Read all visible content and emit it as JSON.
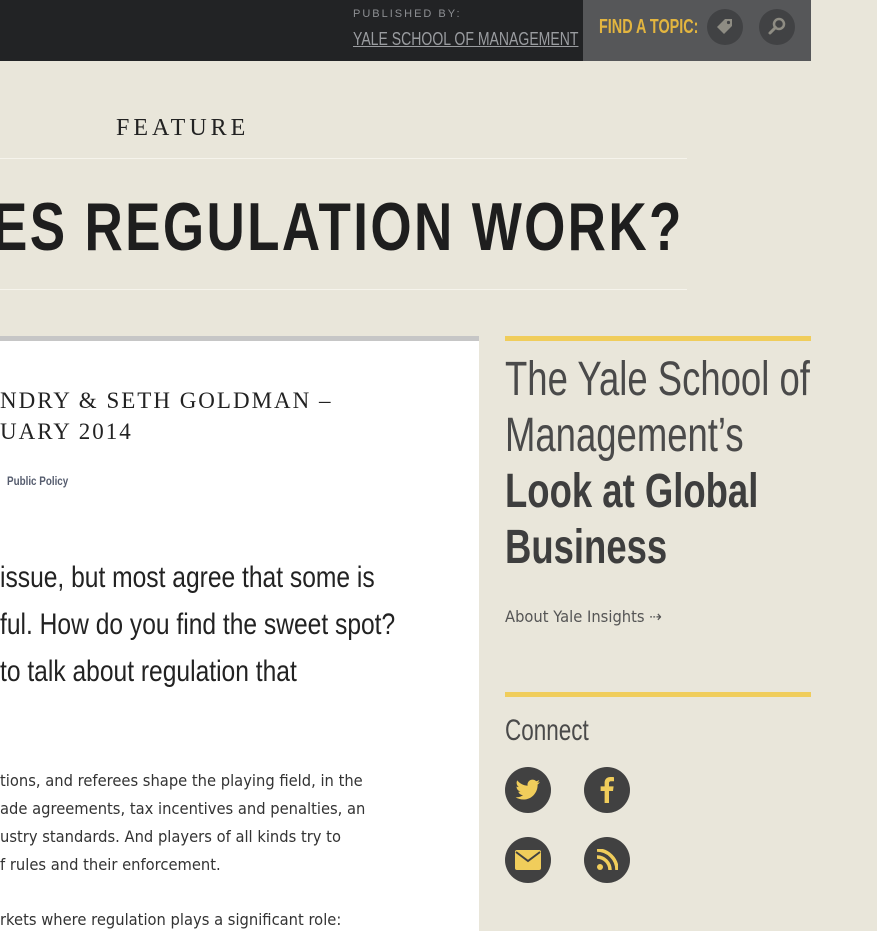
{
  "header": {
    "published_by_label": "PUBLISHED BY:",
    "publisher": "YALE SCHOOL OF MANAGEMENT",
    "find_topic_label": "FIND A TOPIC:",
    "tag_icon": "tag-icon",
    "search_icon": "search-icon"
  },
  "article": {
    "section": "FEATURE",
    "headline": "ES REGULATION WORK?",
    "byline_line1": "NDRY & SETH GOLDMAN –",
    "byline_line2": "UARY 2014",
    "topic_tag": "Public Policy",
    "lede": [
      " issue, but most agree that some is",
      "ful. How do you find the sweet spot?",
      " to talk about regulation that"
    ],
    "body": [
      "tions, and referees shape the playing field, in the",
      "ade agreements, tax incentives and penalties, an",
      "ustry standards. And players of all kinds try to",
      "f rules and their enforcement."
    ],
    "body2": "rkets where regulation plays a significant role:"
  },
  "sidebar": {
    "title_line1": "The Yale School of",
    "title_line2": "Management’s",
    "title_strong1": "Look at Global",
    "title_strong2": "Business",
    "about_link": "About Yale Insights ⇢",
    "connect_label": "Connect",
    "social": [
      "twitter-icon",
      "facebook-icon",
      "email-icon",
      "rss-icon"
    ]
  },
  "colors": {
    "accent": "#f0cd5b",
    "topic_text": "#e3b53f",
    "topbar": "#222325",
    "background": "#e9e6da"
  }
}
